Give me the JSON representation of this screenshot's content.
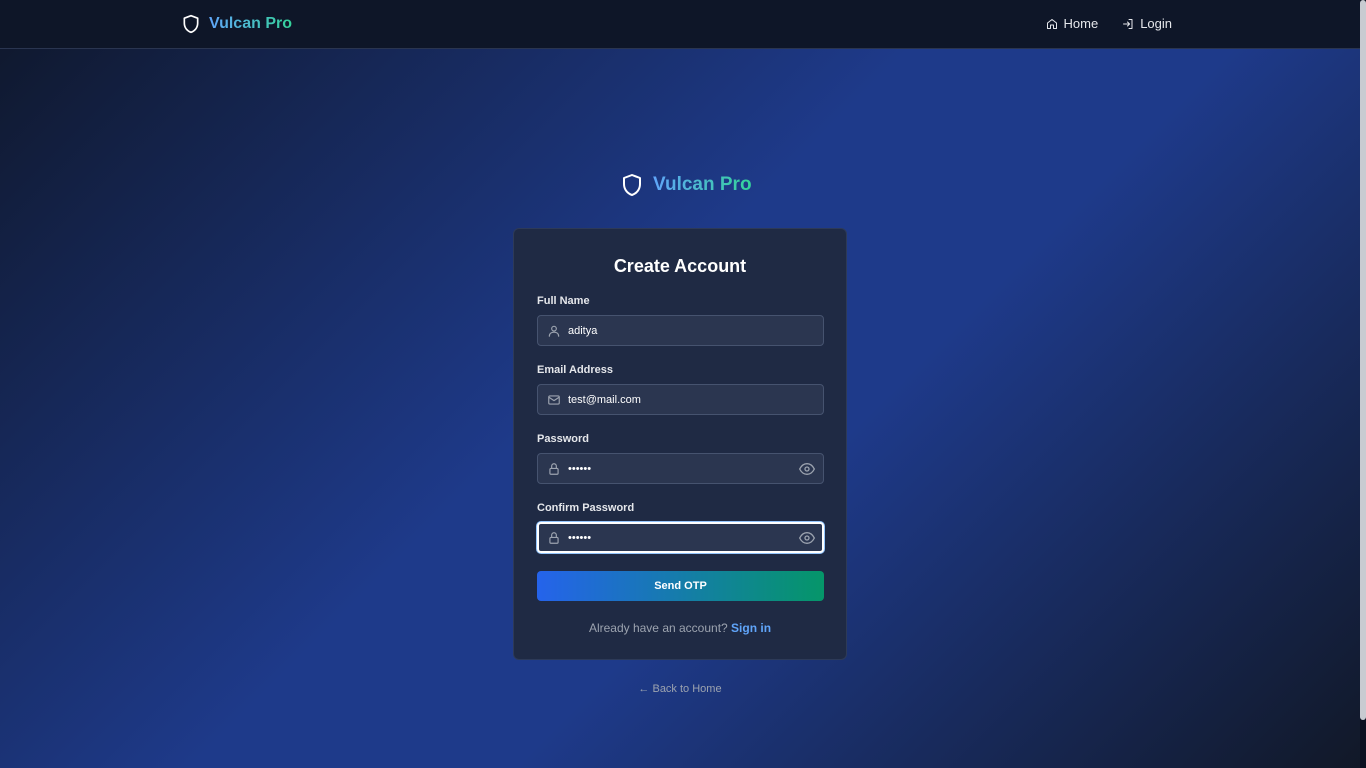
{
  "brand": {
    "name": "Vulcan Pro",
    "gradient_start": "#60a5fa",
    "gradient_end": "#34d399"
  },
  "nav": {
    "items": [
      {
        "label": "Home",
        "icon": "home-icon"
      },
      {
        "label": "Login",
        "icon": "login-icon"
      }
    ]
  },
  "card": {
    "title": "Create Account",
    "fields": {
      "full_name": {
        "label": "Full Name",
        "value": "aditya",
        "icon": "user-icon"
      },
      "email": {
        "label": "Email Address",
        "value": "test@mail.com",
        "icon": "mail-icon"
      },
      "password": {
        "label": "Password",
        "value": "••••••",
        "icon": "lock-icon"
      },
      "confirm_password": {
        "label": "Confirm Password",
        "value": "••••••",
        "icon": "lock-icon",
        "focused": true
      }
    },
    "submit_label": "Send OTP",
    "signin_prompt": "Already have an account?",
    "signin_link": "Sign in"
  },
  "back_home": "← Back to Home",
  "colors": {
    "button_gradient_start": "#2563eb",
    "button_gradient_end": "#059669",
    "link": "#60a5fa",
    "card_bg": "#1f2a44"
  }
}
